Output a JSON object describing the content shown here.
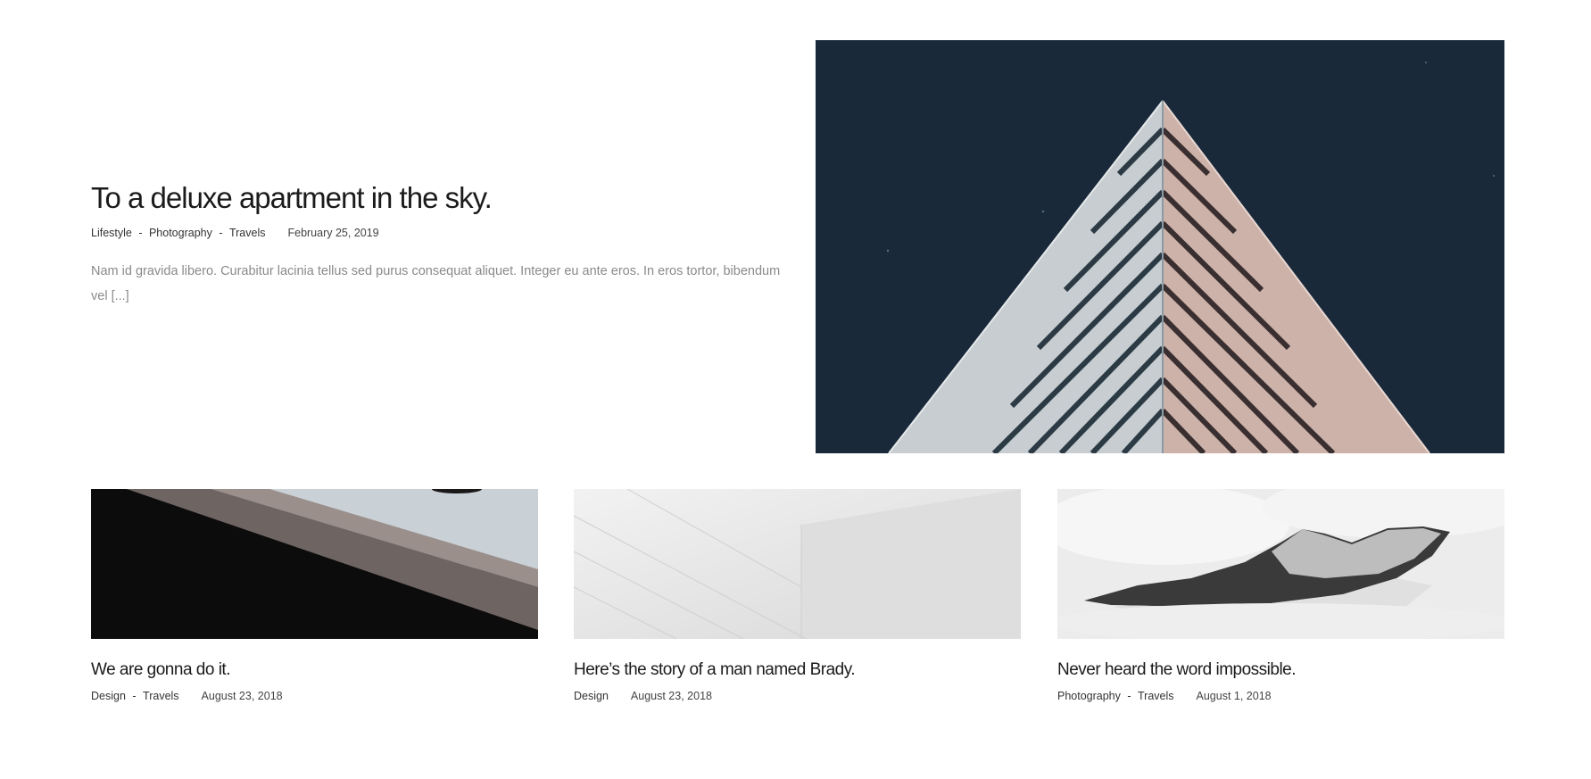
{
  "featured": {
    "title": "To a deluxe apartment in the sky.",
    "categories": [
      "Lifestyle",
      "Photography",
      "Travels"
    ],
    "separator": "-",
    "date": "February 25, 2019",
    "excerpt": "Nam id gravida libero. Curabitur lacinia tellus sed purus consequat aliquet. Integer eu ante eros. In eros tortor, bibendum vel [...]",
    "image_icon": "building-photo"
  },
  "posts": [
    {
      "title": "We are gonna do it.",
      "categories": [
        "Design",
        "Travels"
      ],
      "date": "August 23, 2018",
      "image_icon": "dark-architecture-photo"
    },
    {
      "title": "Here’s the story of a man named Brady.",
      "categories": [
        "Design"
      ],
      "date": "August 23, 2018",
      "image_icon": "white-wall-photo"
    },
    {
      "title": "Never heard the word impossible.",
      "categories": [
        "Photography",
        "Travels"
      ],
      "date": "August 1, 2018",
      "image_icon": "mountain-fog-photo"
    }
  ],
  "colors": {
    "featured_bg": "#19293a",
    "title": "#1b1b1b",
    "excerpt": "#8a8a8a",
    "meta": "#444444"
  }
}
